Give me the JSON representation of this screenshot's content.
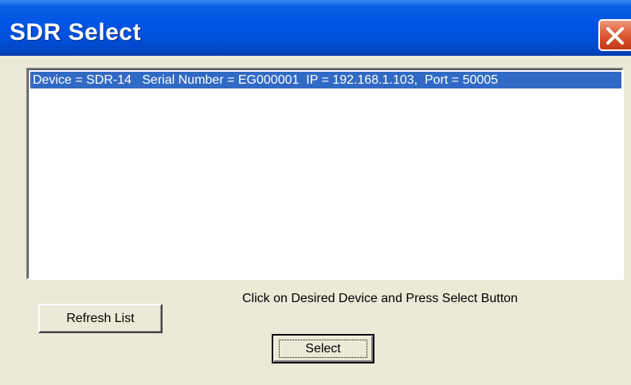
{
  "window": {
    "title": "SDR Select"
  },
  "titlebar": {
    "close_icon": "close-icon",
    "colors": {
      "title_blue": "#0055e5",
      "close_red": "#d34a25"
    }
  },
  "device_list": {
    "items": [
      {
        "label": "Device = SDR-14   Serial Number = EG000001  IP = 192.168.1.103,  Port = 50005",
        "selected": true
      }
    ],
    "selection_color": "#316ac5"
  },
  "instruction_text": "Click on Desired Device and Press Select Button",
  "buttons": {
    "refresh_label": "Refresh List",
    "select_label": "Select"
  }
}
